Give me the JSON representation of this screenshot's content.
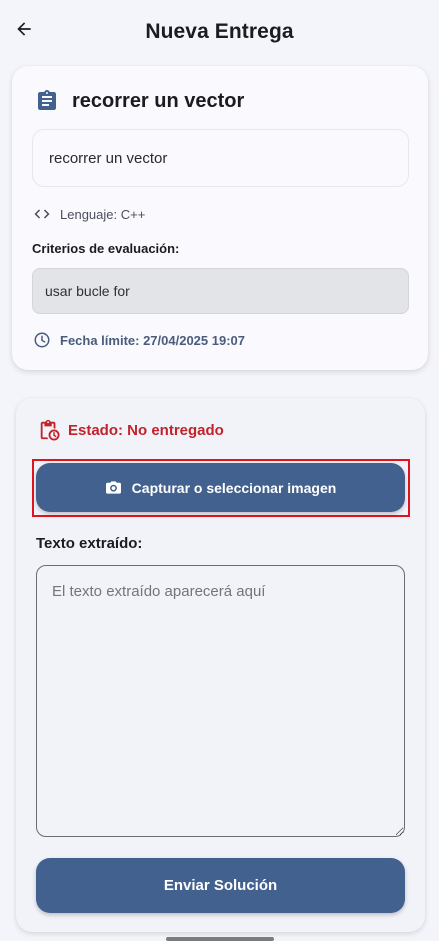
{
  "app_bar": {
    "title": "Nueva Entrega",
    "back_icon": "arrow-left-icon"
  },
  "task": {
    "title": "recorrer un vector",
    "title_icon": "clipboard-icon",
    "description": "recorrer un vector",
    "language_icon": "code-icon",
    "language": "Lenguaje: C++",
    "criteria_label": "Criterios de evaluación:",
    "criteria": "usar bucle for",
    "deadline_icon": "clock-icon",
    "deadline": "Fecha límite: 27/04/2025 19:07"
  },
  "submission": {
    "status_icon": "pending-actions-icon",
    "status": "Estado: No entregado",
    "capture_icon": "camera-icon",
    "capture_label": "Capturar o seleccionar imagen",
    "text_label": "Texto extraído:",
    "text_placeholder": "El texto extraído aparecerá aquí",
    "text_value": "",
    "submit_label": "Enviar Solución"
  },
  "colors": {
    "primary": "#43618f",
    "status_error": "#c2232b",
    "highlight_border": "#e0141e",
    "background": "#f4f5fa"
  }
}
